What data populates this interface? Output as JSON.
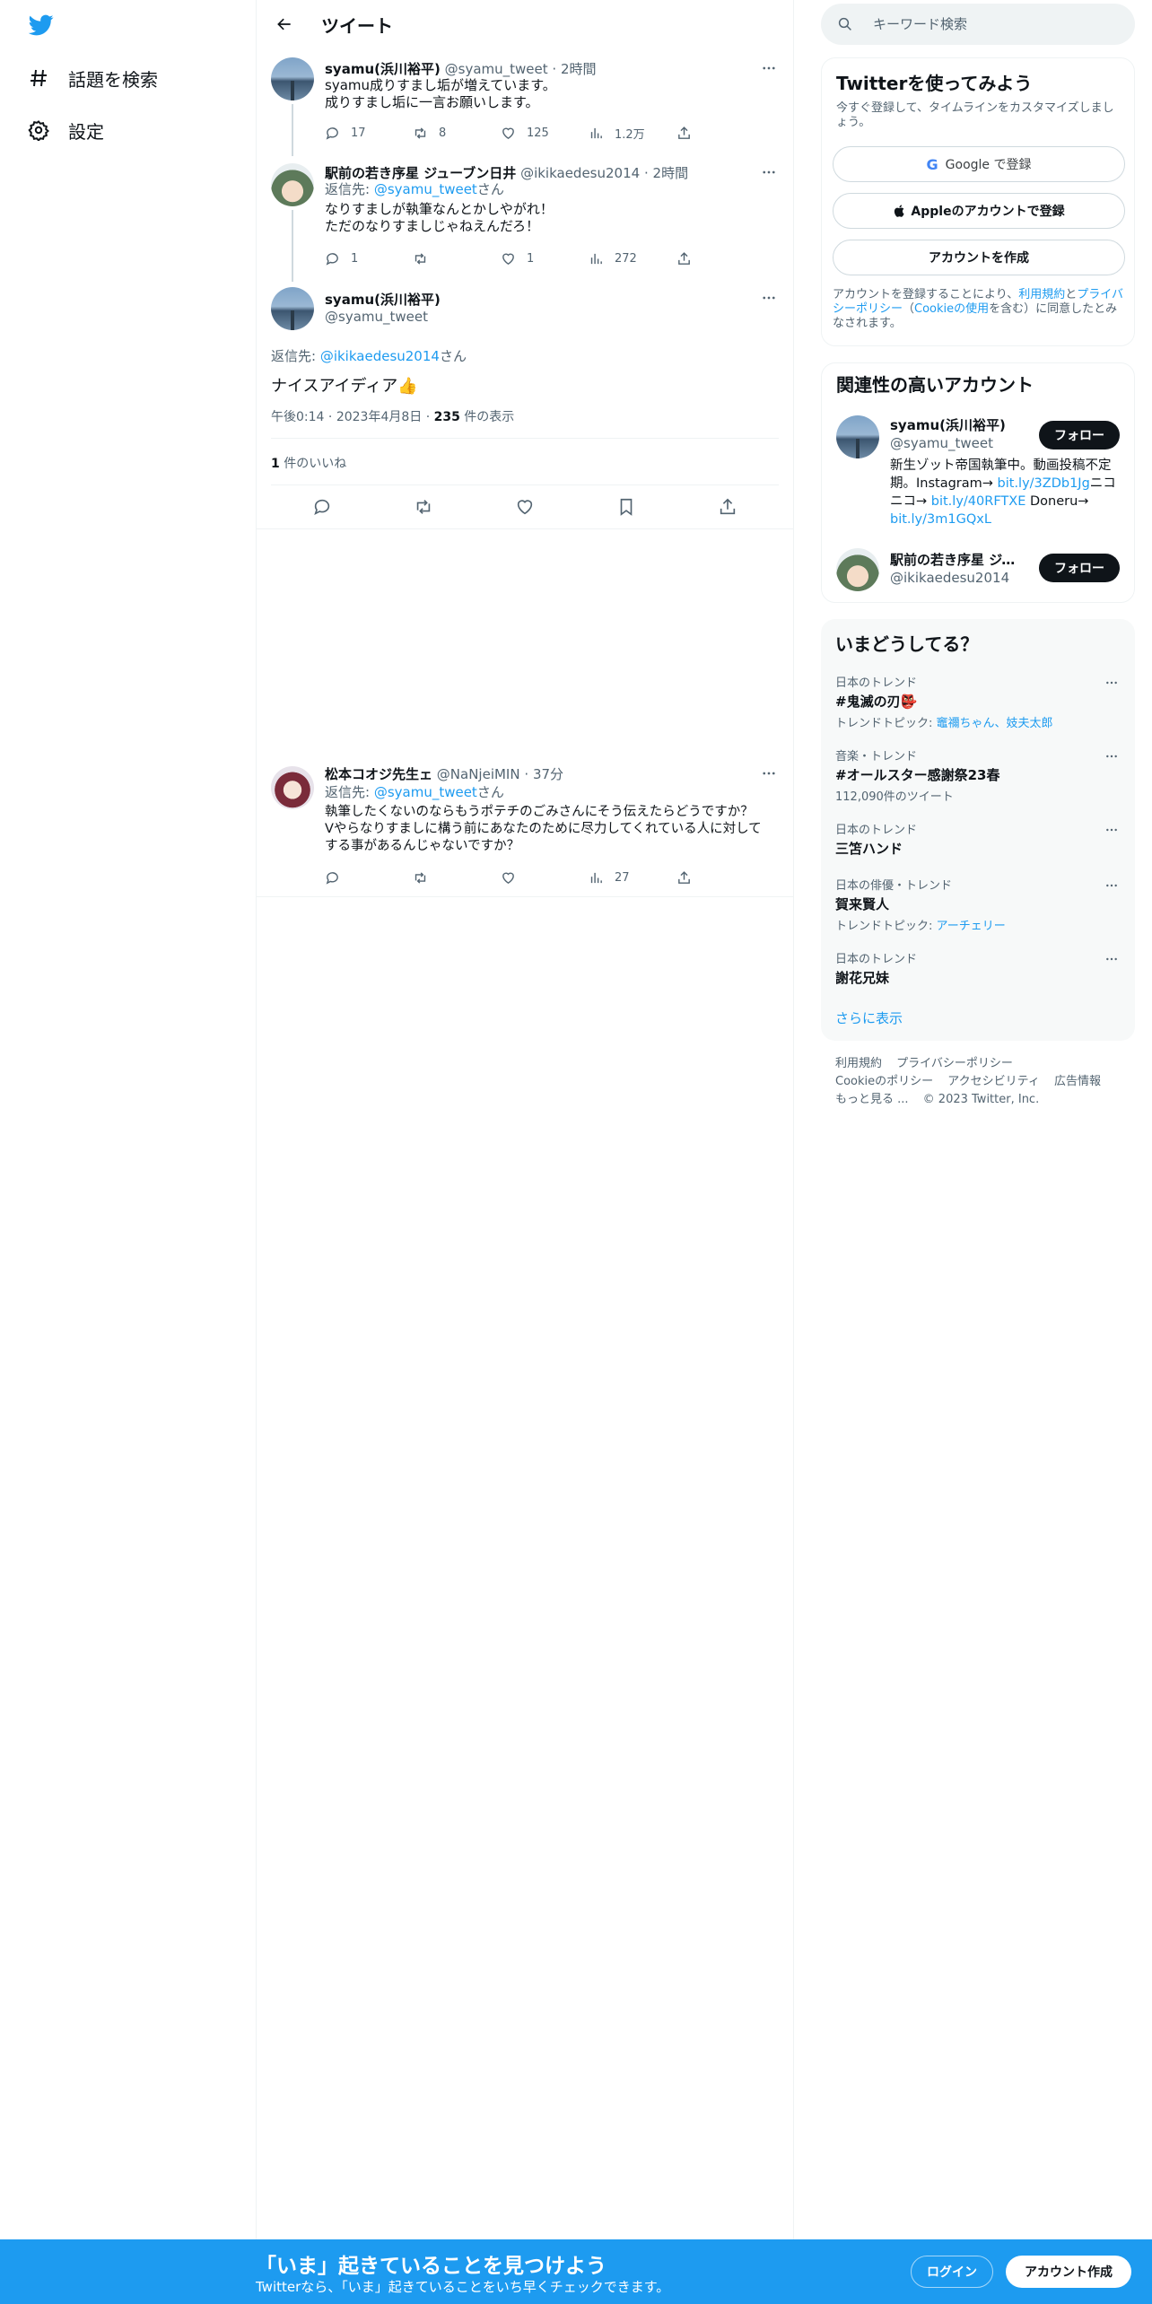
{
  "nav": {
    "explore_label": "話題を検索",
    "settings_label": "設定"
  },
  "header": {
    "title": "ツイート"
  },
  "thread": [
    {
      "name": "syamu(浜川裕平)",
      "handle": "@syamu_tweet",
      "time": "2時間",
      "lines": [
        "syamu成りすまし垢が増えています。",
        "成りすまし垢に一言お願いします。"
      ],
      "stats": {
        "replies": "17",
        "retweets": "8",
        "likes": "125",
        "views": "1.2万"
      }
    },
    {
      "name": "駅前の若き序星 ジューブン日井",
      "handle": "@ikikaedesu2014",
      "time": "2時間",
      "reply_prefix": "返信先: ",
      "reply_to": "@syamu_tweet",
      "reply_suffix": "さん",
      "lines": [
        "なりすましが執筆なんとかしやがれ！",
        "ただのなりすましじゃねえんだろ！"
      ],
      "stats": {
        "replies": "1",
        "retweets": "",
        "likes": "1",
        "views": "272"
      }
    }
  ],
  "main_tweet": {
    "name": "syamu(浜川裕平)",
    "handle": "@syamu_tweet",
    "reply_prefix": "返信先: ",
    "reply_to": "@ikikaedesu2014",
    "reply_suffix": "さん",
    "text": "ナイスアイディア👍",
    "time": "午後0:14",
    "date": "2023年4月8日",
    "views_count": "235",
    "views_label": " 件の表示",
    "likes_count": "1",
    "likes_label": " 件のいいね"
  },
  "reply": {
    "name": "松本コオジ先生ェ",
    "handle": "@NaNjeiMIN",
    "time": "37分",
    "reply_prefix": "返信先: ",
    "reply_to": "@syamu_tweet",
    "reply_suffix": "さん",
    "lines": [
      "執筆したくないのならもうポテチのごみさんにそう伝えたらどうですか？",
      "Vやらなりすましに構う前にあなたのために尽力してくれている人に対して",
      "する事があるんじゃないですか？"
    ],
    "stats": {
      "replies": "",
      "retweets": "",
      "likes": "",
      "views": "27"
    }
  },
  "search": {
    "placeholder": "キーワード検索"
  },
  "signup": {
    "title": "Twitterを使ってみよう",
    "subtitle": "今すぐ登録して、タイムラインをカスタマイズしましょう。",
    "google_label": "Google で登録",
    "apple_label": "Appleのアカウントで登録",
    "create_label": "アカウントを作成",
    "legal_prefix": "アカウントを登録することにより、",
    "terms_link": "利用規約",
    "legal_and": "と",
    "privacy_link": "プライバシーポリシー",
    "legal_mid": "（",
    "cookie_link": "Cookieの使用",
    "legal_suffix": "を含む）に同意したとみなされます。"
  },
  "related": {
    "title": "関連性の高いアカウント",
    "follow_label": "フォロー",
    "accounts": [
      {
        "name": "syamu(浜川裕平)",
        "handle": "@syamu_tweet",
        "bio_a": "新生ゾット帝国執筆中。動画投稿不定期。Instagram→ ",
        "link_a": "bit.ly/3ZDb1Jg",
        "bio_b": "ニコニコ→ ",
        "link_b": "bit.ly/40RFTXE",
        "bio_c": " Doneru→ ",
        "link_c": "bit.ly/3m1GQxL"
      },
      {
        "name": "駅前の若き序星 ジュ...",
        "handle": "@ikikaedesu2014"
      }
    ]
  },
  "trends": {
    "title": "いまどうしてる？",
    "items": [
      {
        "category": "日本のトレンド",
        "title": "#鬼滅の刃",
        "emoji": "👺",
        "sub_prefix": "トレンドトピック: ",
        "sub_link": "竈禰ちゃん、妓夫太郎",
        "sub": ""
      },
      {
        "category": "音楽・トレンド",
        "title": "#オールスター感謝祭23春",
        "sub": "112,090件のツイート"
      },
      {
        "category": "日本のトレンド",
        "title": "三笘ハンド",
        "sub": ""
      },
      {
        "category": "日本の俳優・トレンド",
        "title": "賀来賢人",
        "sub_prefix": "トレンドトピック: ",
        "sub_link": "アーチェリー",
        "sub": ""
      },
      {
        "category": "日本のトレンド",
        "title": "謝花兄妹",
        "sub": ""
      }
    ],
    "show_more": "さらに表示"
  },
  "footer": {
    "terms": "利用規約",
    "privacy": "プライバシーポリシー",
    "cookie": "Cookieのポリシー",
    "accessibility": "アクセシビリティ",
    "ads": "広告情報",
    "more": "もっと見る ...",
    "copyright": "© 2023 Twitter, Inc."
  },
  "bottom_bar": {
    "title": "「いま」起きていることを見つけよう",
    "subtitle": "Twitterなら、「いま」起きていることをいち早くチェックできます。",
    "login_label": "ログイン",
    "signup_label": "アカウント作成"
  },
  "colors": {
    "accent": "#1d9bf0",
    "text": "#0f1419",
    "muted": "#536471"
  }
}
